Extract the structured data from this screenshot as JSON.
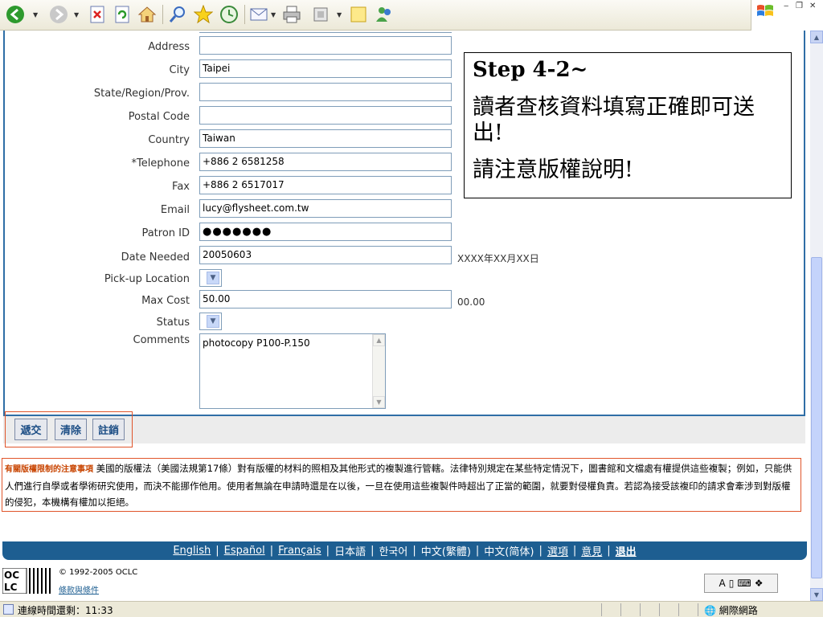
{
  "browser": {
    "toolbar_icons": [
      "back-icon",
      "forward-icon",
      "stop-icon",
      "refresh-icon",
      "home-icon",
      "search-icon",
      "favorites-icon",
      "history-icon",
      "mail-icon",
      "print-icon",
      "edit-icon",
      "discuss-icon",
      "messenger-icon"
    ],
    "window_controls": [
      "minimize",
      "restore",
      "close"
    ]
  },
  "form": {
    "fields": [
      {
        "label": "Address",
        "value": ""
      },
      {
        "label": "City",
        "value": "Taipei"
      },
      {
        "label": "State/Region/Prov.",
        "value": ""
      },
      {
        "label": "Postal Code",
        "value": ""
      },
      {
        "label": "Country",
        "value": "Taiwan"
      },
      {
        "label": "*Telephone",
        "value": "+886 2 6581258"
      },
      {
        "label": "Fax",
        "value": "+886 2 6517017"
      },
      {
        "label": "Email",
        "value": "lucy@flysheet.com.tw"
      },
      {
        "label": "Patron ID",
        "value": "●●●●●●●"
      },
      {
        "label": "Date Needed",
        "value": "20050603",
        "hint": "XXXX年XX月XX日"
      },
      {
        "label": "Pick-up Location",
        "value": ""
      },
      {
        "label": "Max Cost",
        "value": "50.00",
        "hint": "00.00"
      },
      {
        "label": "Status",
        "value": ""
      },
      {
        "label": "Comments",
        "value": "photocopy P100-P.150"
      }
    ]
  },
  "note": {
    "heading": "Step 4-2~",
    "line1": "讀者查核資料填寫正確即可送出!",
    "line2": "請注意版權說明!"
  },
  "buttons": {
    "submit": "遞交",
    "clear": "清除",
    "cancel": "註銷"
  },
  "notice": {
    "lead": "有關版權限制的注意事項",
    "text": "美國的版權法（美國法規第17條）對有版權的材料的照相及其他形式的複製進行管轄。法律特別規定在某些特定情況下，圖書館和文檔處有權提供這些複製；例如，只能供人們進行自學或者學術研究使用，而決不能挪作他用。使用者無論在申請時還是在以後，一旦在使用這些複製件時超出了正當的範圍，就要對侵權負責。若認為接受該複印的請求會牽涉到對版權的侵犯，本機構有權加以拒絕。"
  },
  "languages": [
    "English",
    "Español",
    "Français",
    "日本語",
    "한국어",
    "中文(繁體)",
    "中文(简体)",
    "選項",
    "意見",
    "退出"
  ],
  "footer": {
    "copyright": "© 1992-2005 OCLC",
    "terms": "條款與條件"
  },
  "status": {
    "left": "連線時間還剩：11:33",
    "zone": "網際網路"
  }
}
